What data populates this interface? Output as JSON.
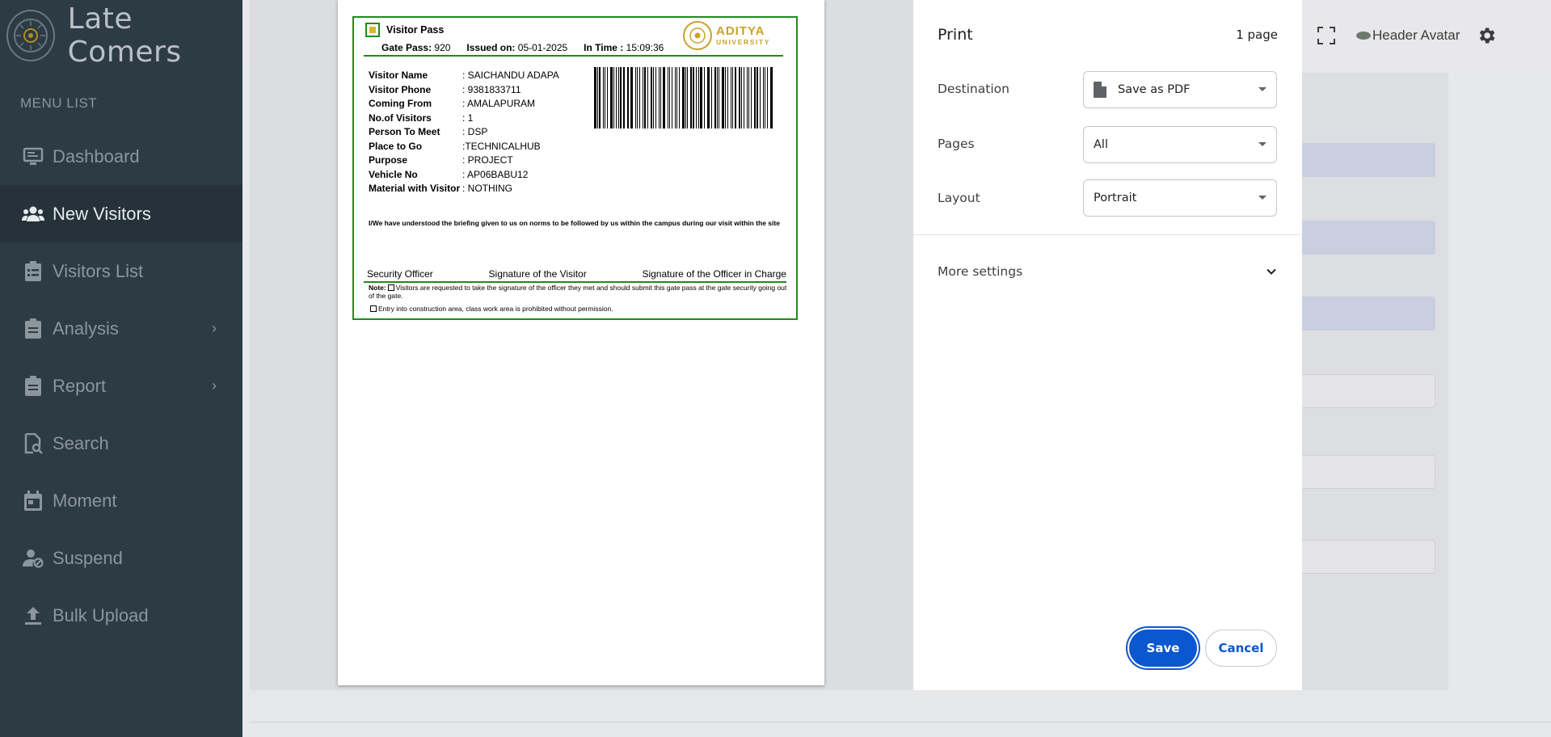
{
  "app": {
    "brand_title": "Late Comers",
    "menu_title": "MENU LIST"
  },
  "sidebar": {
    "items": [
      {
        "label": "Dashboard",
        "icon": "monitor-icon",
        "active": false,
        "has_chevron": false
      },
      {
        "label": "New Visitors",
        "icon": "users-icon",
        "active": true,
        "has_chevron": false
      },
      {
        "label": "Visitors List",
        "icon": "clipboard-list-icon",
        "active": false,
        "has_chevron": false
      },
      {
        "label": "Analysis",
        "icon": "clipboard-icon",
        "active": false,
        "has_chevron": true
      },
      {
        "label": "Report",
        "icon": "clipboard-icon",
        "active": false,
        "has_chevron": true
      },
      {
        "label": "Search",
        "icon": "file-search-icon",
        "active": false,
        "has_chevron": false
      },
      {
        "label": "Moment",
        "icon": "calendar-icon",
        "active": false,
        "has_chevron": false
      },
      {
        "label": "Suspend",
        "icon": "user-block-icon",
        "active": false,
        "has_chevron": false
      },
      {
        "label": "Bulk Upload",
        "icon": "upload-icon",
        "active": false,
        "has_chevron": false
      }
    ]
  },
  "header": {
    "avatar_alt": "Header Avatar",
    "icons": [
      "fullscreen-icon",
      "gear-icon"
    ]
  },
  "pass": {
    "title": "Visitor Pass",
    "gate_pass_label": "Gate Pass:",
    "gate_pass_value": "920",
    "issued_label": "Issued on:",
    "issued_value": "05-01-2025",
    "in_time_label": "In Time :",
    "in_time_value": "15:09:36",
    "university_line1": "ADITYA",
    "university_line2": "UNIVERSITY",
    "fields": [
      {
        "label": "Visitor Name",
        "value": ": SAICHANDU ADAPA"
      },
      {
        "label": "Visitor Phone",
        "value": ": 9381833711"
      },
      {
        "label": "Coming From",
        "value": ": AMALAPURAM"
      },
      {
        "label": "No.of Visitors",
        "value": ": 1"
      },
      {
        "label": "Person To Meet",
        "value": ": DSP"
      },
      {
        "label": "Place to Go",
        "value": ":TECHNICALHUB"
      },
      {
        "label": "Purpose",
        "value": ": PROJECT"
      },
      {
        "label": "Vehicle No",
        "value": ": AP06BABU12"
      },
      {
        "label": "Material with Visitor",
        "value": ": NOTHING"
      }
    ],
    "declaration": "I/We have understood the briefing given to us on norms to be followed by us within the campus during our visit within the site",
    "sig_security": "Security Officer",
    "sig_visitor": "Signature of the Visitor",
    "sig_officer": "Signature of the Officer in Charge",
    "note_label": "Note:",
    "note1": "Visitors are requested to take the signature of the officer they met and should submit this gate pass at the gate security going out of the gate.",
    "note2": "Entry into construction area, class work area is prohibited without permission."
  },
  "print_dialog": {
    "title": "Print",
    "page_count": "1 page",
    "destination_label": "Destination",
    "destination_value": "Save as PDF",
    "pages_label": "Pages",
    "pages_value": "All",
    "layout_label": "Layout",
    "layout_value": "Portrait",
    "more_settings_label": "More settings",
    "save_label": "Save",
    "cancel_label": "Cancel",
    "accent_color": "#0b57d0"
  }
}
